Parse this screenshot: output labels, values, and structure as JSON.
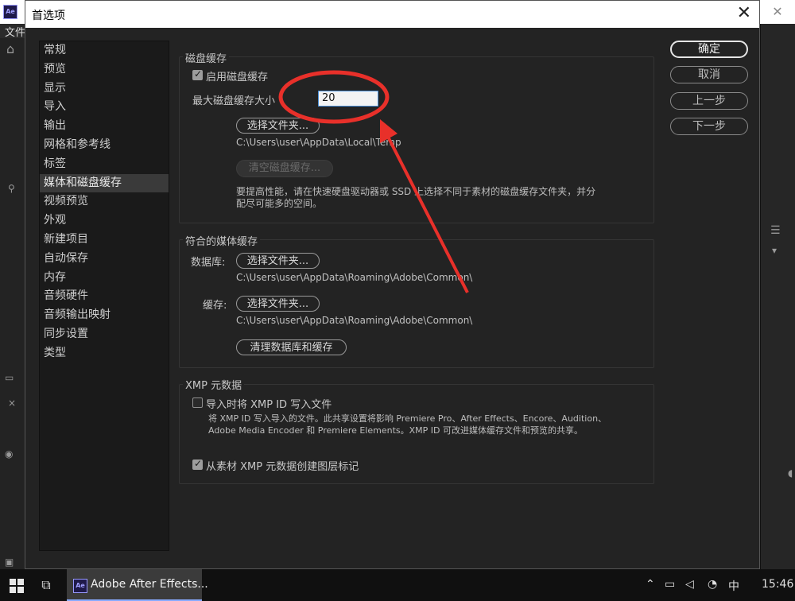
{
  "background": {
    "menu_text": "文件"
  },
  "dialog": {
    "title": "首选项",
    "close_label": "✕"
  },
  "sidebar": {
    "items": [
      {
        "label": "常规"
      },
      {
        "label": "预览"
      },
      {
        "label": "显示"
      },
      {
        "label": "导入"
      },
      {
        "label": "输出"
      },
      {
        "label": "网格和参考线"
      },
      {
        "label": "标签"
      },
      {
        "label": "媒体和磁盘缓存",
        "active": true
      },
      {
        "label": "视频预览"
      },
      {
        "label": "外观"
      },
      {
        "label": "新建项目"
      },
      {
        "label": "自动保存"
      },
      {
        "label": "内存"
      },
      {
        "label": "音频硬件"
      },
      {
        "label": "音频输出映射"
      },
      {
        "label": "同步设置"
      },
      {
        "label": "类型"
      }
    ]
  },
  "side_buttons": {
    "ok": "确定",
    "cancel": "取消",
    "prev": "上一步",
    "next": "下一步"
  },
  "disk_cache": {
    "title": "磁盘缓存",
    "enable_label": "启用磁盘缓存",
    "enable_checked": true,
    "max_size_label": "最大磁盘缓存大小",
    "max_size_value": "20",
    "choose_folder": "选择文件夹...",
    "path": "C:\\Users\\user\\AppData\\Local\\Temp",
    "clear_button": "清空磁盘缓存...",
    "hint_line1": "要提高性能，请在快速硬盘驱动器或 SSD 上选择不同于素材的磁盘缓存文件夹，并分",
    "hint_line2": "配尽可能多的空间。"
  },
  "media_cache": {
    "title": "符合的媒体缓存",
    "database_label": "数据库:",
    "database_button": "选择文件夹...",
    "database_path": "C:\\Users\\user\\AppData\\Roaming\\Adobe\\Common\\",
    "cache_label": "缓存:",
    "cache_button": "选择文件夹...",
    "cache_path": "C:\\Users\\user\\AppData\\Roaming\\Adobe\\Common\\",
    "clean_button": "清理数据库和缓存"
  },
  "xmp": {
    "title": "XMP 元数据",
    "write_label": "导入时将 XMP ID 写入文件",
    "write_checked": false,
    "desc_line1": "将 XMP ID 写入导入的文件。此共享设置将影响 Premiere Pro、After Effects、Encore、Audition、",
    "desc_line2": "Adobe Media Encoder 和 Premiere Elements。XMP ID 可改进媒体缓存文件和预览的共享。",
    "layer_marker_label": "从素材 XMP 元数据创建图层标记",
    "layer_marker_checked": true
  },
  "taskbar": {
    "app_label": "Adobe After Effects...",
    "app_icon": "Ae",
    "time": "15:46"
  },
  "colors": {
    "annotation": "#e8302a",
    "dialog_bg": "#232323",
    "sidebar_active": "#3a3a3a"
  }
}
